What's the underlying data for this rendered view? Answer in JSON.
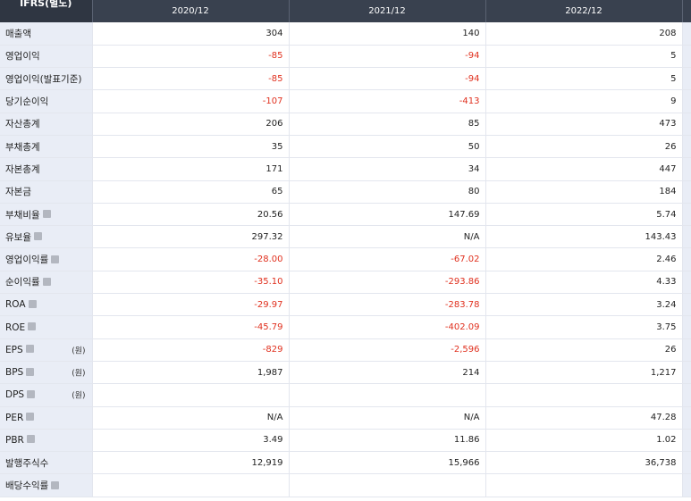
{
  "header": {
    "corner": "IFRS(별도)",
    "periods": [
      "2020/12",
      "2021/12",
      "2022/12"
    ]
  },
  "rows": [
    {
      "label": "매출액",
      "info": false,
      "unit": "",
      "values": [
        "304",
        "140",
        "208"
      ]
    },
    {
      "label": "영업이익",
      "info": false,
      "unit": "",
      "values": [
        "-85",
        "-94",
        "5"
      ]
    },
    {
      "label": "영업이익(발표기준)",
      "info": false,
      "unit": "",
      "values": [
        "-85",
        "-94",
        "5"
      ]
    },
    {
      "label": "당기순이익",
      "info": false,
      "unit": "",
      "values": [
        "-107",
        "-413",
        "9"
      ]
    },
    {
      "label": "자산총계",
      "info": false,
      "unit": "",
      "values": [
        "206",
        "85",
        "473"
      ]
    },
    {
      "label": "부채총계",
      "info": false,
      "unit": "",
      "values": [
        "35",
        "50",
        "26"
      ]
    },
    {
      "label": "자본총계",
      "info": false,
      "unit": "",
      "values": [
        "171",
        "34",
        "447"
      ]
    },
    {
      "label": "자본금",
      "info": false,
      "unit": "",
      "values": [
        "65",
        "80",
        "184"
      ]
    },
    {
      "label": "부채비율",
      "info": true,
      "unit": "",
      "values": [
        "20.56",
        "147.69",
        "5.74"
      ]
    },
    {
      "label": "유보율",
      "info": true,
      "unit": "",
      "values": [
        "297.32",
        "N/A",
        "143.43"
      ]
    },
    {
      "label": "영업이익률",
      "info": true,
      "unit": "",
      "values": [
        "-28.00",
        "-67.02",
        "2.46"
      ]
    },
    {
      "label": "순이익률",
      "info": true,
      "unit": "",
      "values": [
        "-35.10",
        "-293.86",
        "4.33"
      ]
    },
    {
      "label": "ROA",
      "info": true,
      "unit": "",
      "values": [
        "-29.97",
        "-283.78",
        "3.24"
      ]
    },
    {
      "label": "ROE",
      "info": true,
      "unit": "",
      "values": [
        "-45.79",
        "-402.09",
        "3.75"
      ]
    },
    {
      "label": "EPS",
      "info": true,
      "unit": "(원)",
      "values": [
        "-829",
        "-2,596",
        "26"
      ]
    },
    {
      "label": "BPS",
      "info": true,
      "unit": "(원)",
      "values": [
        "1,987",
        "214",
        "1,217"
      ]
    },
    {
      "label": "DPS",
      "info": true,
      "unit": "(원)",
      "values": [
        "",
        "",
        ""
      ]
    },
    {
      "label": "PER",
      "info": true,
      "unit": "",
      "values": [
        "N/A",
        "N/A",
        "47.28"
      ]
    },
    {
      "label": "PBR",
      "info": true,
      "unit": "",
      "values": [
        "3.49",
        "11.86",
        "1.02"
      ]
    },
    {
      "label": "발행주식수",
      "info": false,
      "unit": "",
      "values": [
        "12,919",
        "15,966",
        "36,738"
      ]
    },
    {
      "label": "배당수익률",
      "info": true,
      "unit": "",
      "values": [
        "",
        "",
        ""
      ]
    }
  ],
  "colors": {
    "header_bg": "#39414f",
    "label_bg": "#e9edf6",
    "negative": "#e0301e",
    "text": "#222222"
  },
  "icons": {
    "info": "info-icon"
  }
}
